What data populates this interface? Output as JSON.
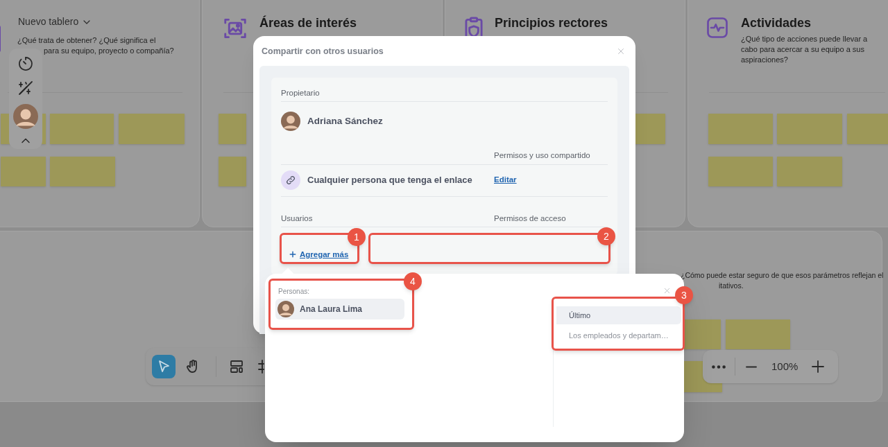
{
  "board": {
    "cards": [
      {
        "kind": "intro",
        "title": "Nuevo tablero",
        "lines": [
          "¿Qué trata de obtener? ¿Qué significa el",
          "para su equipo, proyecto o compañía?"
        ]
      },
      {
        "kind": "image",
        "title": "Áreas de interés"
      },
      {
        "kind": "principles",
        "title": "Principios rectores"
      },
      {
        "kind": "activity",
        "title": "Actividades",
        "lines": [
          "¿Qué tipo de acciones puede llevar a",
          "cabo para acercar a su equipo a sus",
          "aspiraciones?"
        ]
      },
      {
        "kind": "metrics",
        "lines": [
          "¿Cómo puede estar seguro de que esos parámetros reflejan el",
          "itativos."
        ]
      }
    ]
  },
  "bottom_toolbar": {
    "tools": [
      {
        "kind": "select",
        "selected": true
      },
      {
        "kind": "hand",
        "selected": false
      },
      {
        "kind": "layout",
        "selected": false
      },
      {
        "kind": "frame",
        "selected": false
      }
    ]
  },
  "zoom_controls": {
    "zoom_text": "100%"
  },
  "share_dialog": {
    "title": "Compartir con otros usuarios",
    "owner_label": "Propietario",
    "owner_name": "Adriana Sánchez",
    "sharing_label": "Permisos y uso compartido",
    "link_text": "Cualquier persona que tenga el enlace",
    "edit_link": "Editar",
    "users_label": "Usuarios",
    "access_label": "Permisos de acceso",
    "add_more": "Agregar más"
  },
  "add_people_popup": {
    "section_label": "Personas:",
    "people": [
      {
        "name": "Ana Laura Lima"
      }
    ],
    "tabs": [
      {
        "label": "Último",
        "selected": true
      },
      {
        "label": "Los empleados y departam…",
        "selected": false
      }
    ]
  },
  "annotations": [
    {
      "label": "1"
    },
    {
      "label": "2"
    },
    {
      "label": "3"
    },
    {
      "label": "4"
    }
  ]
}
